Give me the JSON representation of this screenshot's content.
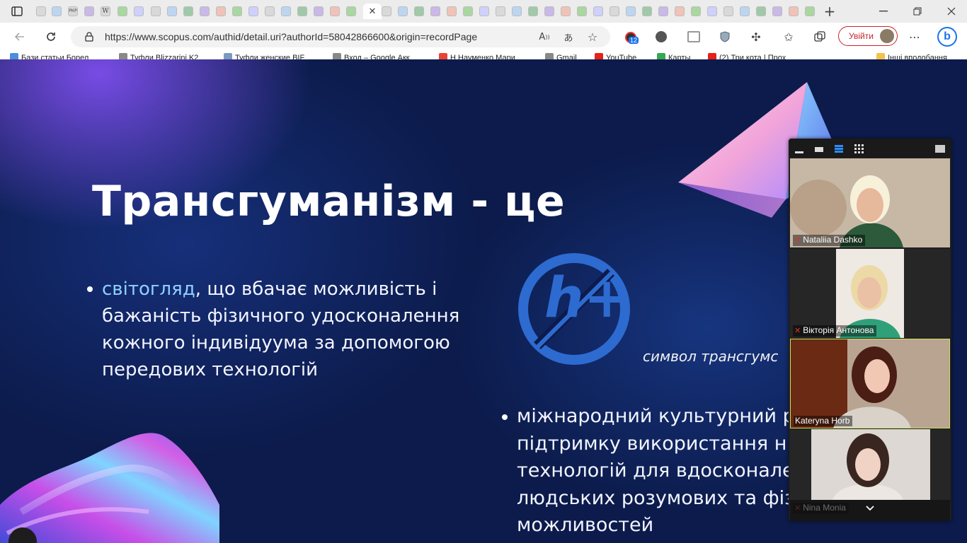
{
  "browser": {
    "url": "https://www.scopus.com/authid/detail.uri?authorId=58042866600&origin=recordPage",
    "signin_label": "Увійти",
    "notification_count": "12",
    "tab_glyphs": [
      "РКР",
      "W"
    ]
  },
  "bookmarks": [
    {
      "label": "Бази статьи Борел",
      "color": "#4a90d9"
    },
    {
      "label": "Туфли Blizzarini K2",
      "color": "#888888"
    },
    {
      "label": "Туфли женские BIF",
      "color": "#7a9abf"
    },
    {
      "label": "Вход – Google Акк",
      "color": "#888888"
    },
    {
      "label": "Н Науменко Мари",
      "color": "#ea4335"
    },
    {
      "label": "Gmail",
      "color": "#888888"
    },
    {
      "label": "YouTube",
      "color": "#e62117"
    },
    {
      "label": "Карты",
      "color": "#34a853"
    },
    {
      "label": "(2) Три кота | Прох",
      "color": "#e62117"
    },
    {
      "label": "Інші вподобання",
      "color": "#f2c14e"
    }
  ],
  "slide": {
    "title": "Трансгуманізм - це",
    "bullet1": {
      "highlight": "світогляд",
      "rest_line1": ", що вбачає можливість і",
      "line2": "бажаність фізичного удосконалення",
      "line3": "кожного індивідуума за допомогою",
      "line4": "передових технологій"
    },
    "logo_text": "h+",
    "caption": "символ трансгумс",
    "bullet2": {
      "line1": "міжнародний культурний р",
      "line2": "підтримку використання н",
      "line3": "технологій для вдосконале",
      "line4": "людських розумових та фіз",
      "line5": "можливостей"
    }
  },
  "zoom": {
    "participants": [
      {
        "name": "Nataliia Dashko",
        "muted": true
      },
      {
        "name": "Вікторія Антонова",
        "muted": true
      },
      {
        "name": "Kateryna Horb",
        "muted": false
      },
      {
        "name": "Nina Monia",
        "muted": true
      }
    ]
  }
}
